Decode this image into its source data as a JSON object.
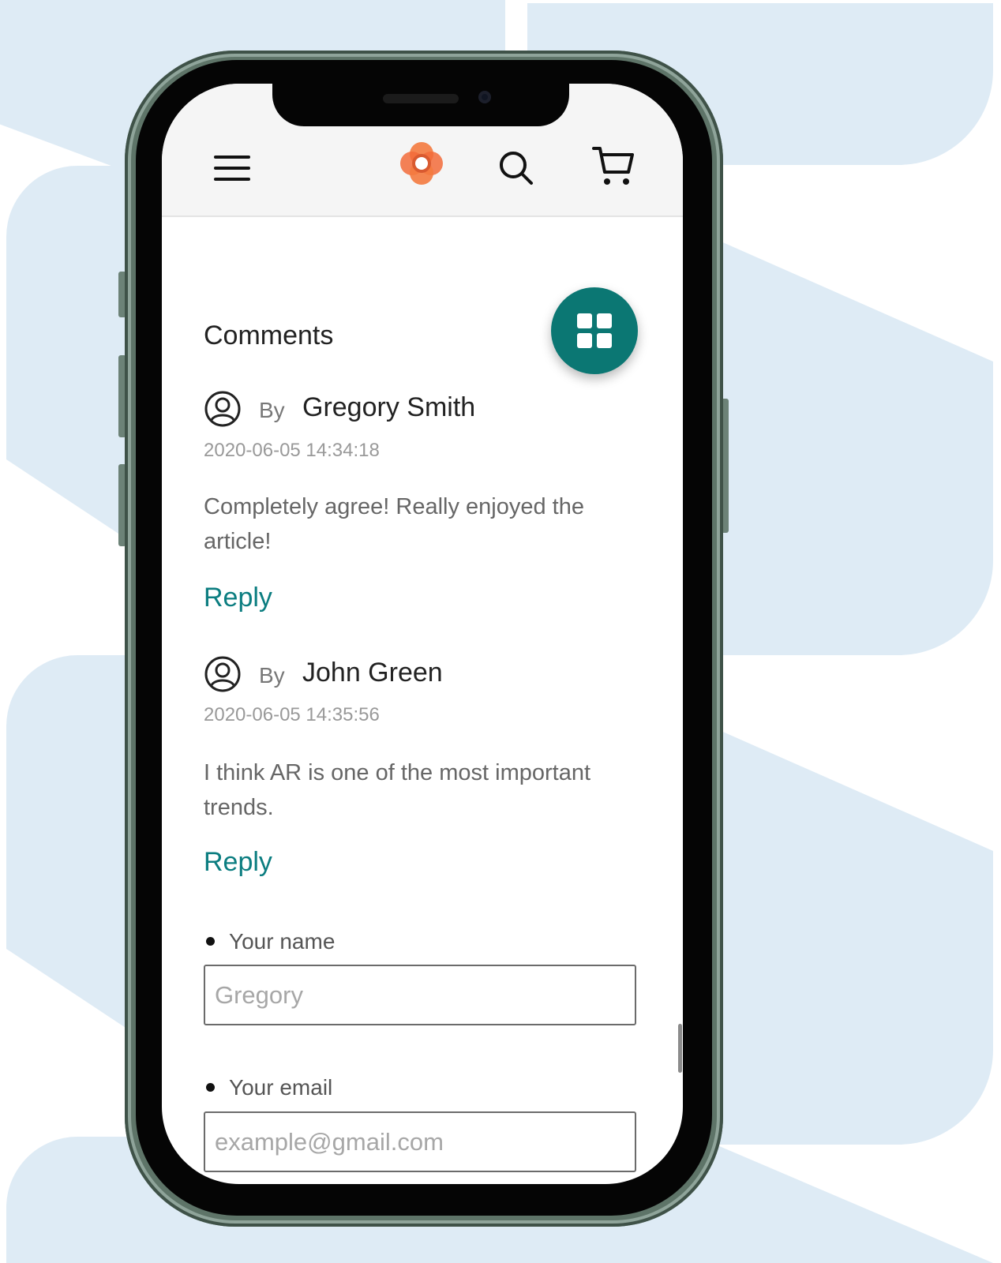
{
  "header": {
    "menu_icon": "hamburger-menu-icon",
    "logo_icon": "flower-logo-icon",
    "search_icon": "search-icon",
    "cart_icon": "shopping-cart-icon"
  },
  "fab": {
    "icon": "grid-icon"
  },
  "comments": {
    "title": "Comments",
    "items": [
      {
        "by_label": "By",
        "author": "Gregory Smith",
        "timestamp": "2020-06-05 14:34:18",
        "text": "Completely agree! Really enjoyed the article!",
        "reply_label": "Reply"
      },
      {
        "by_label": "By",
        "author": "John Green",
        "timestamp": "2020-06-05 14:35:56",
        "text": "I think AR is one of the most important trends.",
        "reply_label": "Reply"
      }
    ]
  },
  "form": {
    "name_label": "Your name",
    "name_placeholder": "Gregory",
    "email_label": "Your email",
    "email_placeholder": "example@gmail.com"
  },
  "colors": {
    "accent": "#0b7773",
    "link": "#0b7d80",
    "logo": "#f26b3a",
    "background_shape": "#deebf5"
  }
}
